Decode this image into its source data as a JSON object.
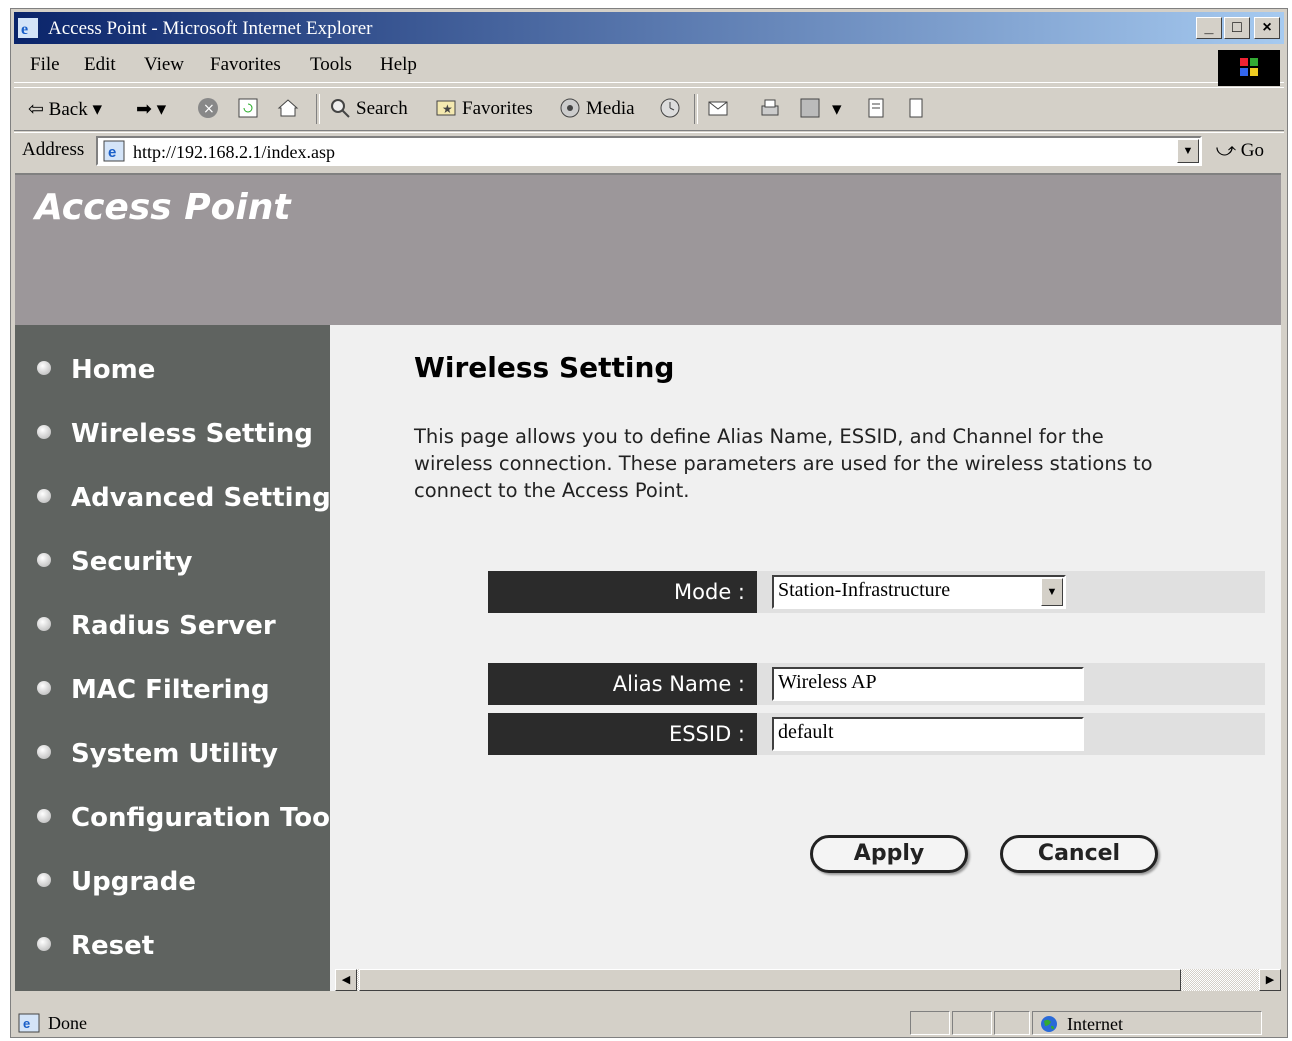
{
  "window": {
    "title": "Access Point - Microsoft Internet Explorer"
  },
  "menu": [
    "File",
    "Edit",
    "View",
    "Favorites",
    "Tools",
    "Help"
  ],
  "toolbar": {
    "back": "Back",
    "search": "Search",
    "favorites": "Favorites",
    "media": "Media"
  },
  "address": {
    "label": "Address",
    "url": "http://192.168.2.1/index.asp",
    "go": "Go"
  },
  "banner": {
    "title": "Access Point"
  },
  "sidebar": {
    "items": [
      {
        "label": "Home"
      },
      {
        "label": "Wireless Setting"
      },
      {
        "label": "Advanced Setting"
      },
      {
        "label": "Security"
      },
      {
        "label": "Radius Server"
      },
      {
        "label": "MAC Filtering"
      },
      {
        "label": "System Utility"
      },
      {
        "label": "Configuration Tool"
      },
      {
        "label": "Upgrade"
      },
      {
        "label": "Reset"
      }
    ]
  },
  "main": {
    "heading": "Wireless Setting",
    "description": "This page allows you to define Alias Name, ESSID, and Channel for the wireless connection. These parameters are used for the wireless stations to connect to the Access Point.",
    "mode": {
      "label": "Mode :",
      "value": "Station-Infrastructure"
    },
    "alias": {
      "label": "Alias Name :",
      "value": "Wireless AP"
    },
    "essid": {
      "label": "ESSID :",
      "value": "default"
    },
    "apply": "Apply",
    "cancel": "Cancel"
  },
  "status": {
    "left": "Done",
    "zone": "Internet"
  }
}
